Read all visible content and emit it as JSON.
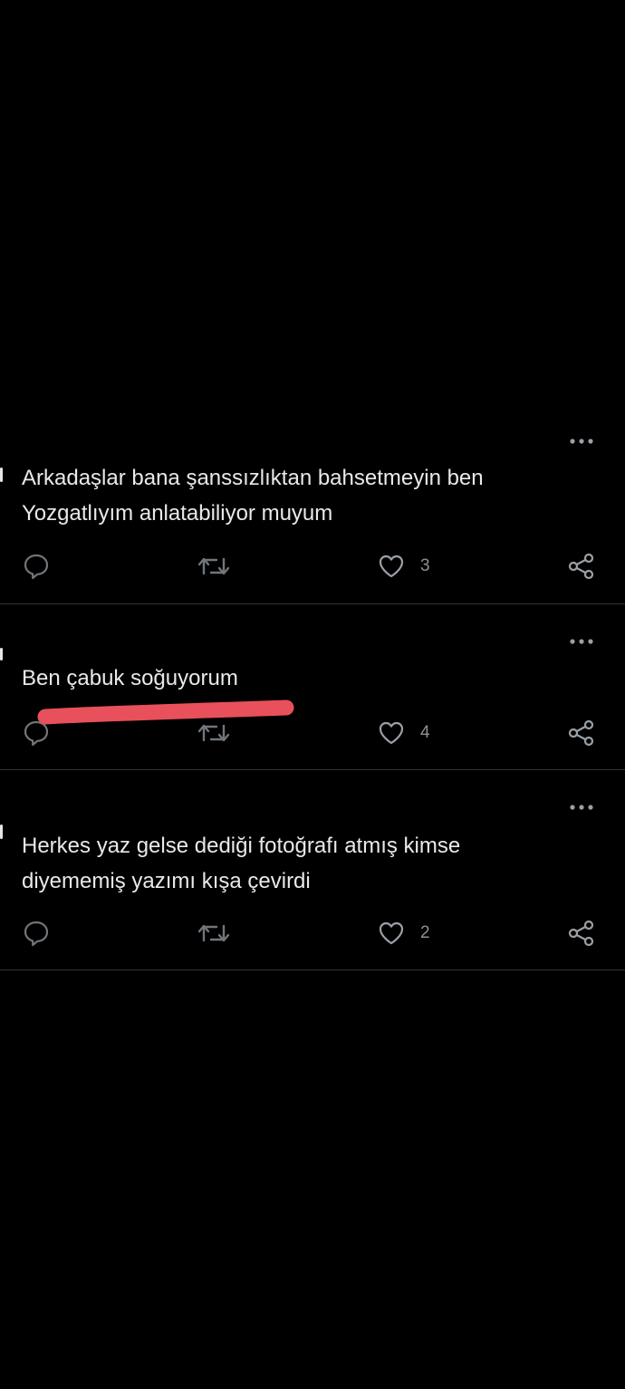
{
  "colors": {
    "background": "#000000",
    "text": "#e7e9ea",
    "icon": "#71767b",
    "divider": "#2f3336",
    "redaction": "#e8505b"
  },
  "tweets": [
    {
      "text": "Arkadaşlar bana şanssızlıktan bahsetmeyin ben\nYozgatlıyım anlatabiliyor muyum",
      "header_fragment": "",
      "like_count": "3",
      "icons": [
        "reply-icon",
        "retweet-icon",
        "heart-icon",
        "share-icon",
        "more-icon"
      ]
    },
    {
      "text": "Ben çabuk soğuyorum",
      "header_fragment": "",
      "like_count": "4",
      "icons": [
        "reply-icon",
        "retweet-icon",
        "heart-icon",
        "share-icon",
        "more-icon"
      ]
    },
    {
      "text": "Herkes yaz gelse dediği fotoğrafı atmış kimse\ndiyememiş yazımı kışa çevirdi",
      "header_fragment": "",
      "like_count": "2",
      "icons": [
        "reply-icon",
        "retweet-icon",
        "heart-icon",
        "share-icon",
        "more-icon"
      ]
    }
  ]
}
